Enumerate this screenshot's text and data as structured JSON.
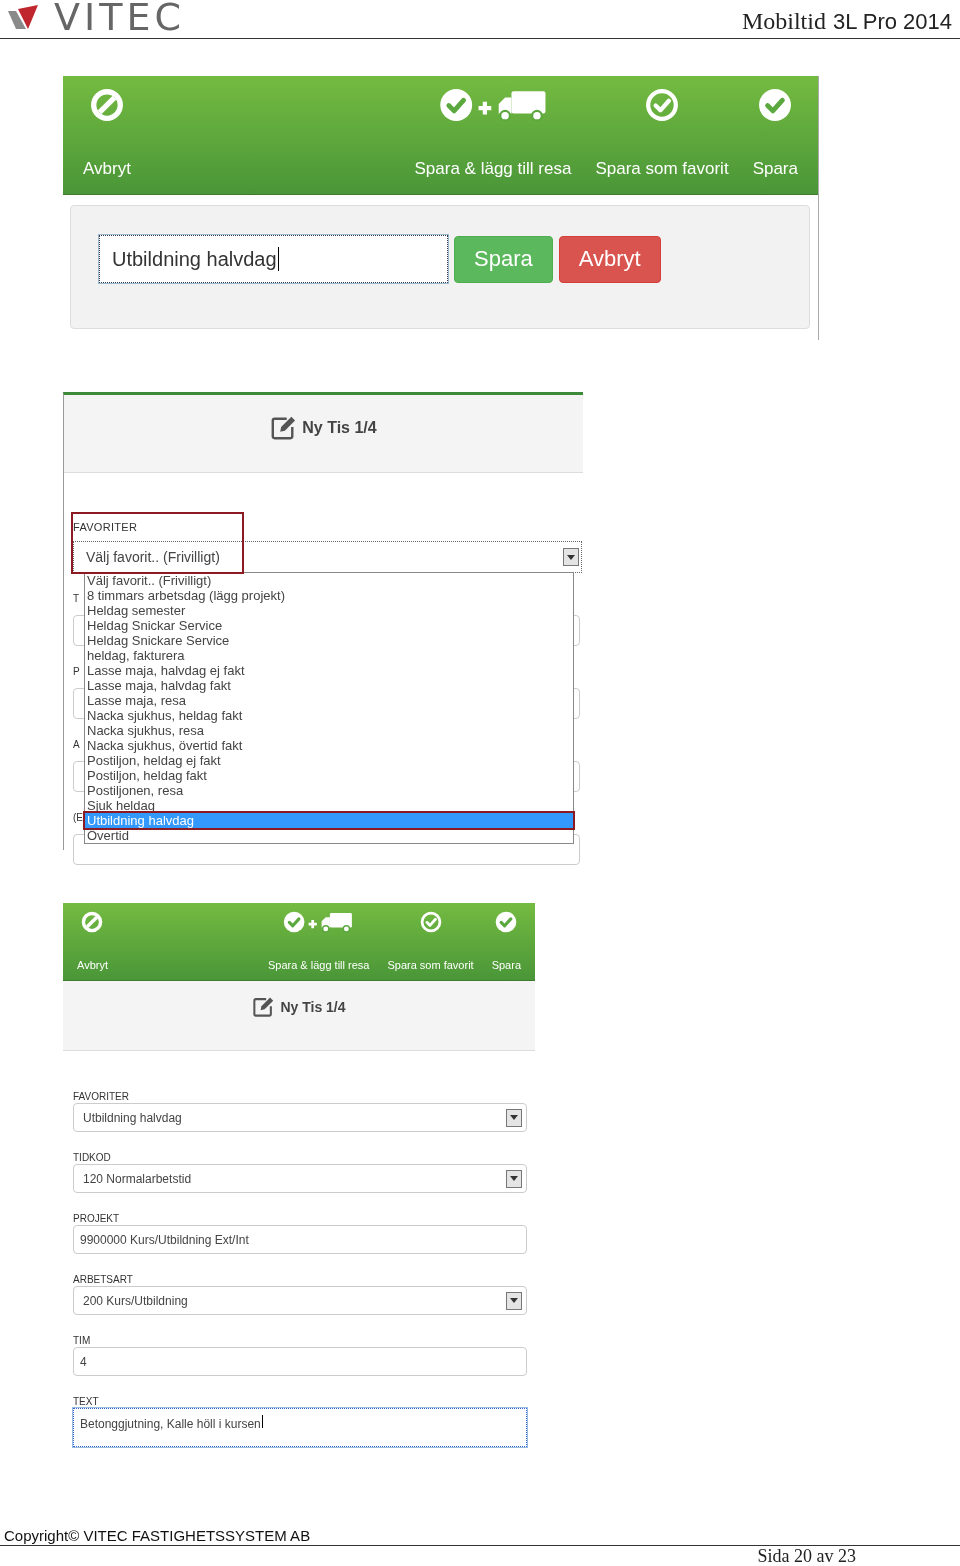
{
  "header": {
    "logo": "VITEC",
    "title_serif": "Mobiltid",
    "title_sans": "3L Pro 2014"
  },
  "screenshot_1": {
    "toolbar": [
      {
        "kind": "cancel",
        "label": "Avbryt"
      },
      {
        "kind": "save_trip",
        "label": "Spara & lägg till resa"
      },
      {
        "kind": "favorite",
        "label": "Spara som favorit"
      },
      {
        "kind": "save",
        "label": "Spara"
      }
    ],
    "favorite_form": {
      "value": "Utbildning halvdag",
      "buttons": [
        {
          "kind": "save",
          "label": "Spara"
        },
        {
          "kind": "cancel",
          "label": "Avbryt"
        }
      ]
    }
  },
  "screenshot_2": {
    "heading": "Ny Tis 1/4",
    "field_label": "FAVORITER",
    "select_value": "Välj favorit.. (Frivilligt)",
    "hidden_labels": [
      "T",
      "P",
      "A",
      "(E"
    ],
    "options": [
      {
        "label": "Välj favorit.. (Frivilligt)",
        "selected": false
      },
      {
        "label": "8 timmars arbetsdag (lägg projekt)",
        "selected": false
      },
      {
        "label": "Heldag semester",
        "selected": false
      },
      {
        "label": "Heldag Snickar Service",
        "selected": false
      },
      {
        "label": "Heldag Snickare Service",
        "selected": false
      },
      {
        "label": "heldag, fakturera",
        "selected": false
      },
      {
        "label": "Lasse maja, halvdag ej fakt",
        "selected": false
      },
      {
        "label": "Lasse maja, halvdag fakt",
        "selected": false
      },
      {
        "label": "Lasse maja, resa",
        "selected": false
      },
      {
        "label": "Nacka sjukhus, heldag fakt",
        "selected": false
      },
      {
        "label": "Nacka sjukhus, resa",
        "selected": false
      },
      {
        "label": "Nacka sjukhus, övertid fakt",
        "selected": false
      },
      {
        "label": "Postiljon, heldag ej fakt",
        "selected": false
      },
      {
        "label": "Postiljon, heldag fakt",
        "selected": false
      },
      {
        "label": "Postiljonen, resa",
        "selected": false
      },
      {
        "label": "Sjuk heldag",
        "selected": false
      },
      {
        "label": "Utbildning halvdag",
        "selected": true
      },
      {
        "label": "Övertid",
        "selected": false
      }
    ]
  },
  "screenshot_3": {
    "toolbar": [
      {
        "kind": "cancel",
        "label": "Avbryt"
      },
      {
        "kind": "save_trip",
        "label": "Spara & lägg till resa"
      },
      {
        "kind": "favorite",
        "label": "Spara som favorit"
      },
      {
        "kind": "save",
        "label": "Spara"
      }
    ],
    "heading": "Ny Tis 1/4",
    "fields": [
      {
        "label": "FAVORITER",
        "value": "Utbildning halvdag",
        "kind": "select"
      },
      {
        "label": "TIDKOD",
        "value": "120 Normalarbetstid",
        "kind": "select"
      },
      {
        "label": "PROJEKT",
        "value": "9900000 Kurs/Utbildning Ext/Int",
        "kind": "text"
      },
      {
        "label": "ARBETSART",
        "value": "200 Kurs/Utbildning",
        "kind": "select"
      },
      {
        "label": "TIM",
        "value": "4",
        "kind": "text"
      },
      {
        "label": "TEXT",
        "value": "Betonggjutning, Kalle höll i kursen",
        "kind": "textarea"
      }
    ]
  },
  "footer": {
    "copyright": "Copyright© VITEC FASTIGHETSSYSTEM AB",
    "page": "Sida 20 av 23"
  }
}
